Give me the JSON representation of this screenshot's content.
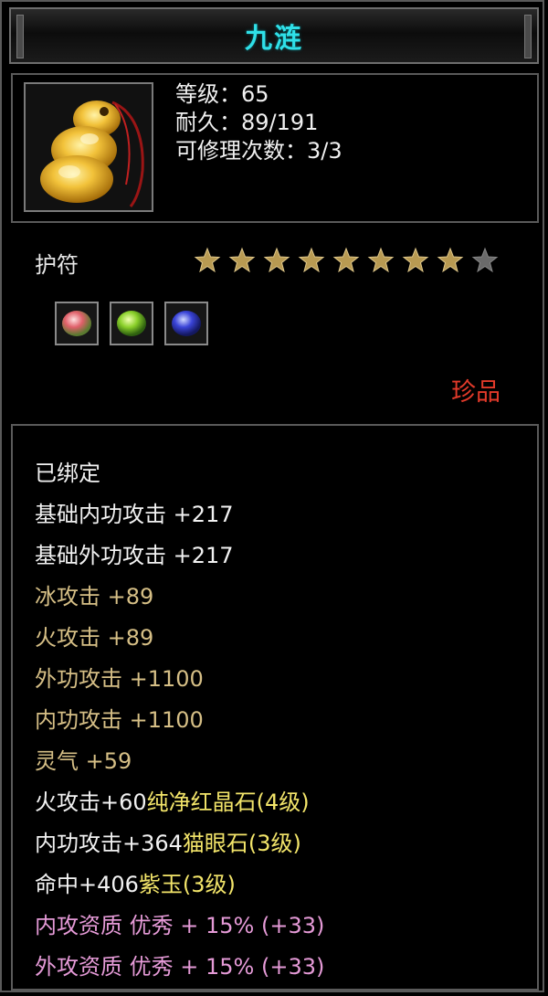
{
  "title": "九涟",
  "header": {
    "level": "等级：65",
    "durability": "耐久：89/191",
    "repairs": "可修理次数：3/3"
  },
  "item_type": "护符",
  "stars": {
    "filled": 8,
    "total": 9
  },
  "gems": [
    "red-gem-icon",
    "green-gem-icon",
    "blue-gem-icon"
  ],
  "rarity": "珍品",
  "details": {
    "bound": "已绑定",
    "base_inner": "基础内功攻击  +217",
    "base_outer": "基础外功攻击  +217",
    "ice": "冰攻击  +89",
    "fire": "火攻击  +89",
    "outer": "外功攻击  +1100",
    "inner": "内功攻击  +1100",
    "spirit": "灵气  +59",
    "gem1_a": "火攻击+60",
    "gem1_b": "纯净红晶石(4级)",
    "gem2_a": "内功攻击+364",
    "gem2_b": "猫眼石(3级)",
    "gem3_a": "命中+406",
    "gem3_b": "紫玉(3级)",
    "q_inner": "内攻资质  优秀  +  15% (+33)",
    "q_outer": "外攻资质  优秀  +  15% (+33)"
  },
  "colors": {
    "title": "#2fe0e8",
    "rarity": "#e23a2a",
    "bonus": "#d6bf86",
    "gem_name": "#f3e56a",
    "quality": "#e59ad7"
  }
}
